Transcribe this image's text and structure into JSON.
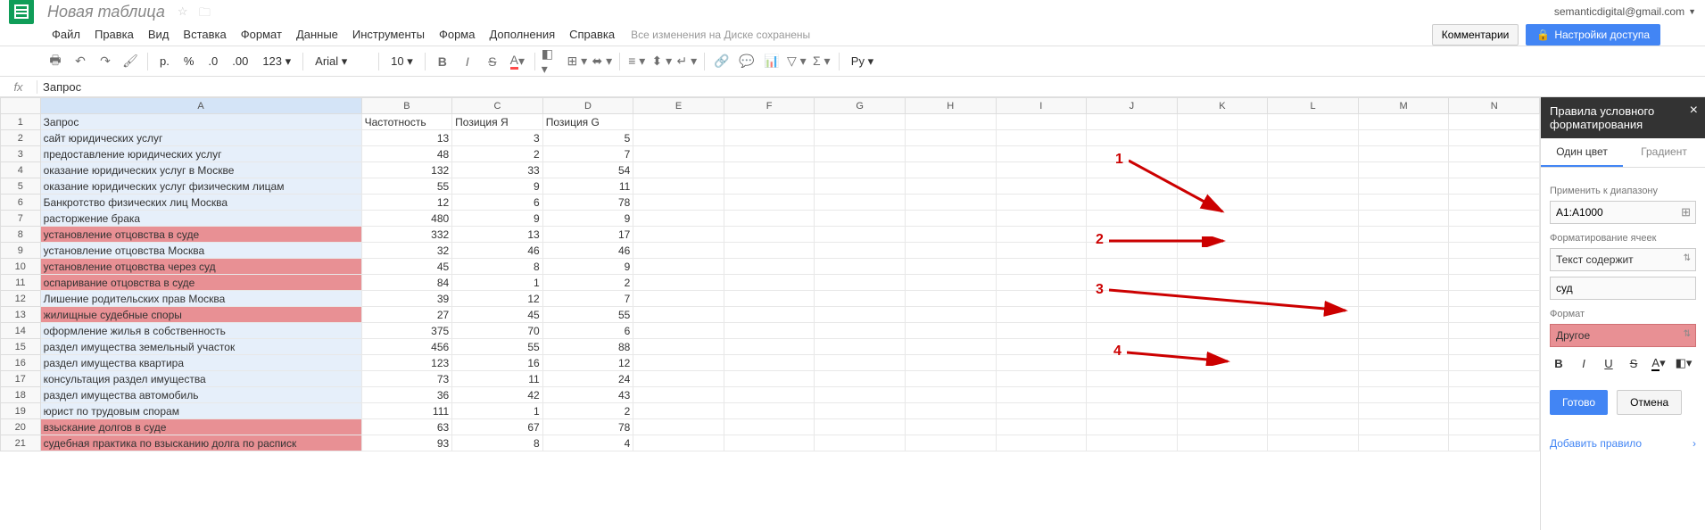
{
  "header": {
    "title": "Новая таблица",
    "user_email": "semanticdigital@gmail.com"
  },
  "menu": {
    "file": "Файл",
    "edit": "Правка",
    "view": "Вид",
    "insert": "Вставка",
    "format": "Формат",
    "data": "Данные",
    "tools": "Инструменты",
    "form": "Форма",
    "addons": "Дополнения",
    "help": "Справка",
    "save_status": "Все изменения на Диске сохранены",
    "comments": "Комментарии",
    "share": "Настройки доступа"
  },
  "toolbar": {
    "currency": "p.",
    "percent": "%",
    "dec_dec": ".0",
    "dec_inc": ".00",
    "more_fmt": "123",
    "font": "Arial",
    "size": "10",
    "lang": "Ру"
  },
  "formula": {
    "fx": "fx",
    "value": "Запрос"
  },
  "columns": [
    "A",
    "B",
    "C",
    "D",
    "E",
    "F",
    "G",
    "H",
    "I",
    "J",
    "K",
    "L",
    "M",
    "N"
  ],
  "head_row": [
    "Запрос",
    "Частотность",
    "Позиция Я",
    "Позиция G"
  ],
  "rows": [
    {
      "a": "сайт юридических услуг",
      "b": 13,
      "c": 3,
      "d": 5,
      "hl": false
    },
    {
      "a": "предоставление юридических услуг",
      "b": 48,
      "c": 2,
      "d": 7,
      "hl": false
    },
    {
      "a": "оказание юридических услуг в Москве",
      "b": 132,
      "c": 33,
      "d": 54,
      "hl": false
    },
    {
      "a": "оказание юридических услуг физическим лицам",
      "b": 55,
      "c": 9,
      "d": 11,
      "hl": false
    },
    {
      "a": "Банкротство физических лиц Москва",
      "b": 12,
      "c": 6,
      "d": 78,
      "hl": false
    },
    {
      "a": "расторжение брака",
      "b": 480,
      "c": 9,
      "d": 9,
      "hl": false
    },
    {
      "a": "установление отцовства в суде",
      "b": 332,
      "c": 13,
      "d": 17,
      "hl": true
    },
    {
      "a": "установление отцовства Москва",
      "b": 32,
      "c": 46,
      "d": 46,
      "hl": false
    },
    {
      "a": "установление отцовства через суд",
      "b": 45,
      "c": 8,
      "d": 9,
      "hl": true
    },
    {
      "a": "оспаривание отцовства в суде",
      "b": 84,
      "c": 1,
      "d": 2,
      "hl": true
    },
    {
      "a": "Лишение родительских прав Москва",
      "b": 39,
      "c": 12,
      "d": 7,
      "hl": false
    },
    {
      "a": "жилищные судебные споры",
      "b": 27,
      "c": 45,
      "d": 55,
      "hl": true
    },
    {
      "a": "оформление жилья в собственность",
      "b": 375,
      "c": 70,
      "d": 6,
      "hl": false
    },
    {
      "a": "раздел имущества земельный участок",
      "b": 456,
      "c": 55,
      "d": 88,
      "hl": false
    },
    {
      "a": "раздел имущества квартира",
      "b": 123,
      "c": 16,
      "d": 12,
      "hl": false
    },
    {
      "a": "консультация раздел имущества",
      "b": 73,
      "c": 11,
      "d": 24,
      "hl": false
    },
    {
      "a": "раздел имущества автомобиль",
      "b": 36,
      "c": 42,
      "d": 43,
      "hl": false
    },
    {
      "a": "юрист по трудовым спорам",
      "b": 111,
      "c": 1,
      "d": 2,
      "hl": false
    },
    {
      "a": "взыскание долгов в суде",
      "b": 63,
      "c": 67,
      "d": 78,
      "hl": true
    },
    {
      "a": "судебная практика по взысканию долга по расписк",
      "b": 93,
      "c": 8,
      "d": 4,
      "hl": true
    }
  ],
  "panel": {
    "title": "Правила условного форматирования",
    "tab_single": "Один цвет",
    "tab_gradient": "Градиент",
    "apply_to": "Применить к диапазону",
    "range": "A1:A1000",
    "format_cells": "Форматирование ячеек",
    "condition": "Текст содержит",
    "value": "суд",
    "format_label": "Формат",
    "other": "Другое",
    "done": "Готово",
    "cancel": "Отмена",
    "add_rule": "Добавить правило"
  },
  "annotations": {
    "n1": "1",
    "n2": "2",
    "n3": "3",
    "n4": "4"
  }
}
